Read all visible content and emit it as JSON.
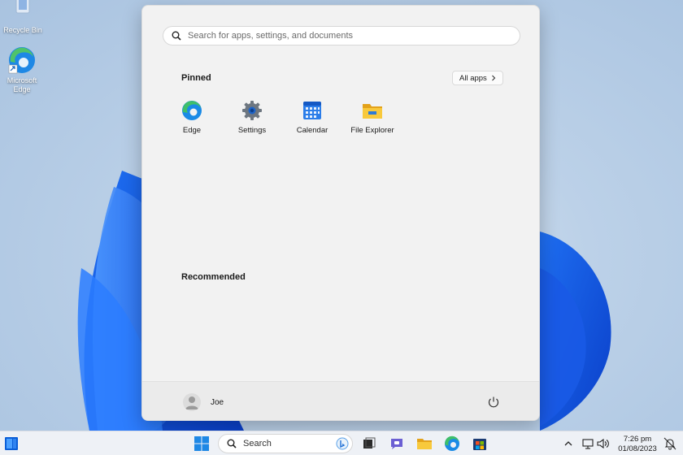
{
  "desktop": {
    "icons": [
      {
        "label": "Recycle Bin",
        "icon": "recycle-bin-icon"
      },
      {
        "label": "Microsoft Edge",
        "icon": "edge-icon"
      }
    ]
  },
  "start_menu": {
    "search": {
      "placeholder": "Search for apps, settings, and documents",
      "value": ""
    },
    "pinned_title": "Pinned",
    "all_apps_label": "All apps",
    "pinned_apps": [
      {
        "label": "Edge",
        "icon": "edge-icon"
      },
      {
        "label": "Settings",
        "icon": "gear-icon"
      },
      {
        "label": "Calendar",
        "icon": "calendar-icon"
      },
      {
        "label": "File Explorer",
        "icon": "folder-icon"
      }
    ],
    "recommended_title": "Recommended",
    "user": {
      "name": "Joe"
    }
  },
  "taskbar": {
    "search_label": "Search",
    "clock": {
      "time": "7:26 pm",
      "date": "01/08/2023"
    }
  },
  "colors": {
    "accent": "#0067c0",
    "start_bg": "#f2f2f2",
    "taskbar_bg": "#eef1f6"
  }
}
